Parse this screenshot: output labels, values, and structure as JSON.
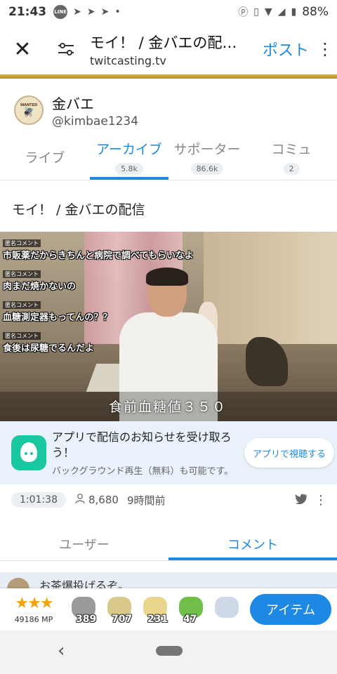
{
  "status_bar": {
    "time": "21:43",
    "notif_icons": [
      "line-app-icon",
      "send-icon",
      "send-icon",
      "send-icon",
      "dot-icon"
    ],
    "battery": "88%"
  },
  "browser": {
    "title": "モイ！ / 金バエの配…",
    "domain": "twitcasting.tv",
    "post_label": "ポスト"
  },
  "profile": {
    "name": "金バエ",
    "handle": "@kimbae1234",
    "avatar_text": "WANTED"
  },
  "tabs": [
    {
      "label": "ライブ",
      "badge": ""
    },
    {
      "label": "アーカイブ",
      "badge": "5.8k"
    },
    {
      "label": "サポーター",
      "badge": "86.6k"
    },
    {
      "label": "コミュ",
      "badge": "2"
    }
  ],
  "movie_title": "モイ！ / 金バエの配信",
  "video": {
    "comments": [
      {
        "tag": "匿名コメント",
        "text": "市販薬だからきちんと病院で調べてもらいなよ"
      },
      {
        "tag": "匿名コメント",
        "text": "肉まだ焼かないの"
      },
      {
        "tag": "匿名コメント",
        "text": "血糖測定器もってんの？？"
      },
      {
        "tag": "匿名コメント",
        "text": "食後は尿糖でるんだよ"
      }
    ],
    "subtitle": "食前血糖値３５０"
  },
  "app_banner": {
    "main": "アプリで配信のお知らせを受け取ろう！",
    "sub": "バックグラウンド再生（無料）も可能です。",
    "button": "アプリで視聴する"
  },
  "meta": {
    "duration": "1:01:38",
    "viewers": "8,680",
    "ago": "9時間前"
  },
  "content_tabs": {
    "user": "ユーザー",
    "comment": "コメント"
  },
  "peek_text": "お茶爆投げるぞ。",
  "item_bar": {
    "mp": "49186 MP",
    "items": [
      {
        "count": "389",
        "icon": "coin-stack-icon",
        "color": "#9a9a9a"
      },
      {
        "count": "707",
        "icon": "tea-cup-icon",
        "color": "#d9c98a"
      },
      {
        "count": "231",
        "icon": "tea-cup-icon",
        "color": "#e8d68c"
      },
      {
        "count": "47",
        "icon": "frog-icon",
        "color": "#6fbf4a"
      },
      {
        "count": "",
        "icon": "mascot-icon",
        "color": "#cfd8e6"
      }
    ],
    "button": "アイテム"
  }
}
